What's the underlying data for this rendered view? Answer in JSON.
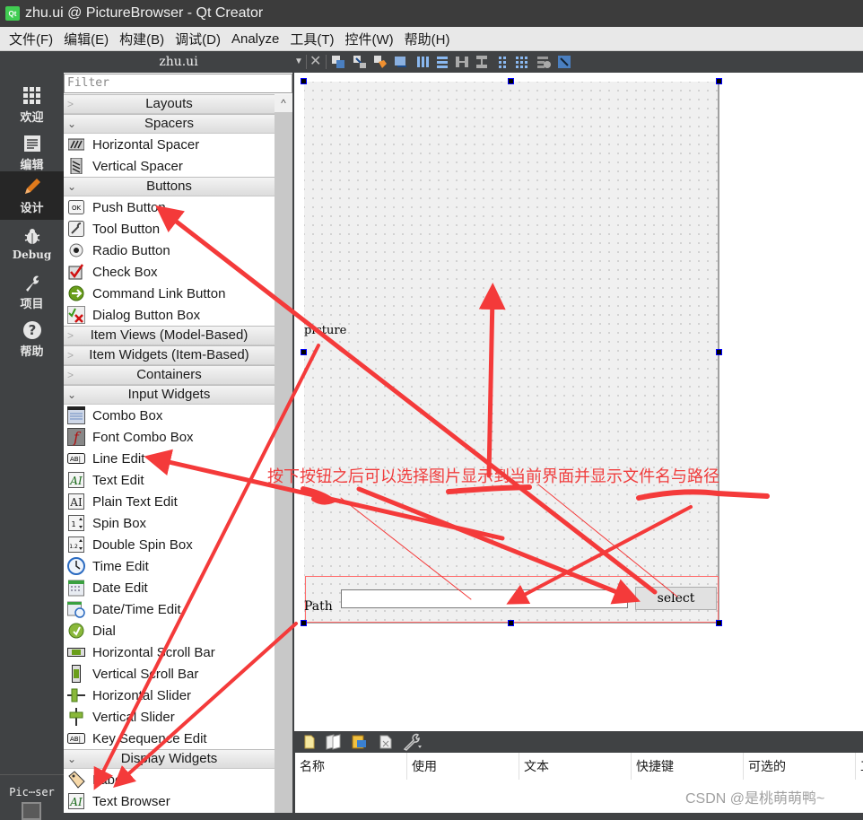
{
  "window": {
    "title": "zhu.ui @ PictureBrowser - Qt Creator",
    "app_icon": "qt-logo-icon"
  },
  "menubar": {
    "items": [
      {
        "label": "文件(F)"
      },
      {
        "label": "编辑(E)"
      },
      {
        "label": "构建(B)"
      },
      {
        "label": "调试(D)"
      },
      {
        "label": "Analyze"
      },
      {
        "label": "工具(T)"
      },
      {
        "label": "控件(W)"
      },
      {
        "label": "帮助(H)"
      }
    ]
  },
  "modebar": {
    "items": [
      {
        "label": "欢迎",
        "icon": "grid-icon",
        "active": false
      },
      {
        "label": "编辑",
        "icon": "document-icon",
        "active": false
      },
      {
        "label": "设计",
        "icon": "pencil-icon",
        "active": true
      },
      {
        "label": "Debug",
        "icon": "bug-icon",
        "active": false
      },
      {
        "label": "项目",
        "icon": "wrench-icon",
        "active": false
      },
      {
        "label": "帮助",
        "icon": "help-icon",
        "active": false
      }
    ],
    "project_selector": "Pic⋯ser"
  },
  "document": {
    "filename": "zhu.ui"
  },
  "form_toolbar": {
    "icons": [
      "edit-widgets-icon",
      "edit-signals-slots-icon",
      "edit-buddies-icon",
      "edit-tab-order-icon",
      "layout-horizontal-icon",
      "layout-vertical-icon",
      "layout-horizontal-splitter-icon",
      "layout-vertical-splitter-icon",
      "layout-form-icon",
      "layout-grid-icon",
      "break-layout-icon",
      "adjust-size-icon"
    ]
  },
  "widget_box": {
    "filter_placeholder": "Filter",
    "categories": [
      {
        "name": "Layouts",
        "expanded": false,
        "items": []
      },
      {
        "name": "Spacers",
        "expanded": true,
        "items": [
          "Horizontal Spacer",
          "Vertical Spacer"
        ]
      },
      {
        "name": "Buttons",
        "expanded": true,
        "items": [
          "Push Button",
          "Tool Button",
          "Radio Button",
          "Check Box",
          "Command Link Button",
          "Dialog Button Box"
        ]
      },
      {
        "name": "Item Views (Model-Based)",
        "expanded": false,
        "items": []
      },
      {
        "name": "Item Widgets (Item-Based)",
        "expanded": false,
        "items": []
      },
      {
        "name": "Containers",
        "expanded": false,
        "items": []
      },
      {
        "name": "Input Widgets",
        "expanded": true,
        "items": [
          "Combo Box",
          "Font Combo Box",
          "Line Edit",
          "Text Edit",
          "Plain Text Edit",
          "Spin Box",
          "Double Spin Box",
          "Time Edit",
          "Date Edit",
          "Date/Time Edit",
          "Dial",
          "Horizontal Scroll Bar",
          "Vertical Scroll Bar",
          "Horizontal Slider",
          "Vertical Slider",
          "Key Sequence Edit"
        ]
      },
      {
        "name": "Display Widgets",
        "expanded": true,
        "items": [
          "Label",
          "Text Browser"
        ]
      }
    ]
  },
  "form": {
    "picture_label": "picture",
    "path_label": "Path",
    "path_value": "",
    "select_button": "select"
  },
  "annotation": {
    "text": "按下按钮之后可以选择图片显示到当前界面并显示文件名与路径",
    "color": "#f03c3c"
  },
  "action_editor": {
    "toolbar_icons": [
      "new-action-icon",
      "copy-action-icon",
      "paste-action-icon",
      "delete-action-icon",
      "configure-icon"
    ],
    "columns": [
      "名称",
      "使用",
      "文本",
      "快捷键",
      "可选的",
      "工"
    ]
  },
  "watermark": "CSDN @是桃萌萌鸭~"
}
